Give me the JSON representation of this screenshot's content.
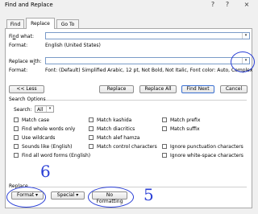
{
  "window": {
    "title": "Find and Replace",
    "minimize": "?",
    "maximize": "?",
    "close": "×"
  },
  "tabs": [
    "Find",
    "Replace",
    "Go To"
  ],
  "find": {
    "label_pre": "Fi",
    "label_key": "n",
    "label_post": "d what:",
    "value": "",
    "format_label": "Format:",
    "format_value": "English (United States)"
  },
  "replace": {
    "label_pre": "Replace w",
    "label_key": "i",
    "label_post": "th:",
    "value": "",
    "format_label": "Format:",
    "format_value": "Font: (Default) Simplified Arabic, 12 pt, Not Bold, Not Italic, Font color: Auto, Complex S..."
  },
  "buttons": {
    "less": "<< Less",
    "replace": "Replace",
    "replace_all": "Replace All",
    "find_next": "Find Next",
    "cancel": "Cancel",
    "format": "Format ▾",
    "special": "Special ▾",
    "no_formatting": "No Formatting"
  },
  "search_options": {
    "title": "Search Options",
    "search_label": "Search:",
    "search_value": "All"
  },
  "options_left": [
    "Match case",
    "Find whole words only",
    "Use wildcards",
    "Sounds like (English)",
    "Find all word forms (English)"
  ],
  "options_mid": [
    "Match kashida",
    "Match diacritics",
    "Match alef hamza",
    "Match control characters"
  ],
  "options_right": [
    "Match prefix",
    "Match suffix",
    "",
    "Ignore punctuation characters",
    "Ignore white-space characters"
  ],
  "replace_section": {
    "title": "Replace"
  },
  "annotations": {
    "digit_5": "5",
    "digit_6": "6",
    "color": "#2a3fd6"
  }
}
